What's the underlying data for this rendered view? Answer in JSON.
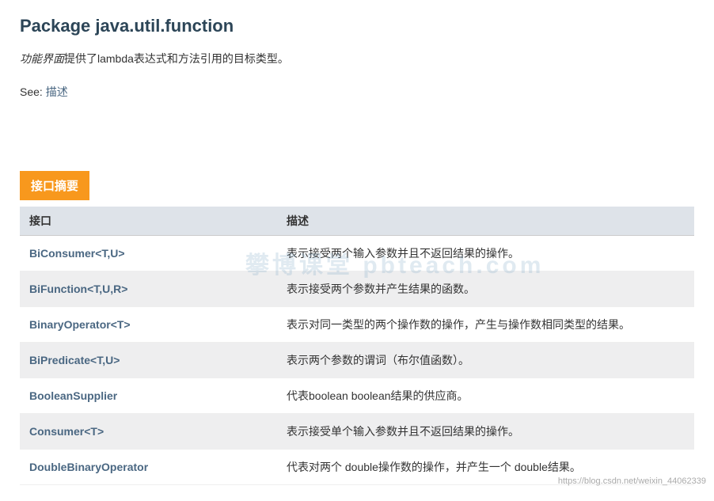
{
  "title": "Package java.util.function",
  "descriptionItalic": "功能界面",
  "descriptionRest": "提供了lambda表达式和方法引用的目标类型。",
  "seeLabel": "See: ",
  "seeLinkText": "描述",
  "sectionHeader": "接口摘要",
  "tableHeaders": {
    "interface": "接口",
    "description": "描述"
  },
  "rows": [
    {
      "name": "BiConsumer<T,U>",
      "desc": "表示接受两个输入参数并且不返回结果的操作。"
    },
    {
      "name": "BiFunction<T,U,R>",
      "desc": "表示接受两个参数并产生结果的函数。"
    },
    {
      "name": "BinaryOperator<T>",
      "desc": "表示对同一类型的两个操作数的操作，产生与操作数相同类型的结果。"
    },
    {
      "name": "BiPredicate<T,U>",
      "desc": "表示两个参数的谓词（布尔值函数）。"
    },
    {
      "name": "BooleanSupplier",
      "desc": "代表boolean boolean结果的供应商。"
    },
    {
      "name": "Consumer<T>",
      "desc": "表示接受单个输入参数并且不返回结果的操作。"
    },
    {
      "name": "DoubleBinaryOperator",
      "desc": "代表对两个 double操作数的操作，并产生一个 double结果。"
    }
  ],
  "watermark": "攀博课堂 pbteach.com",
  "footerWatermark": "https://blog.csdn.net/weixin_44062339"
}
